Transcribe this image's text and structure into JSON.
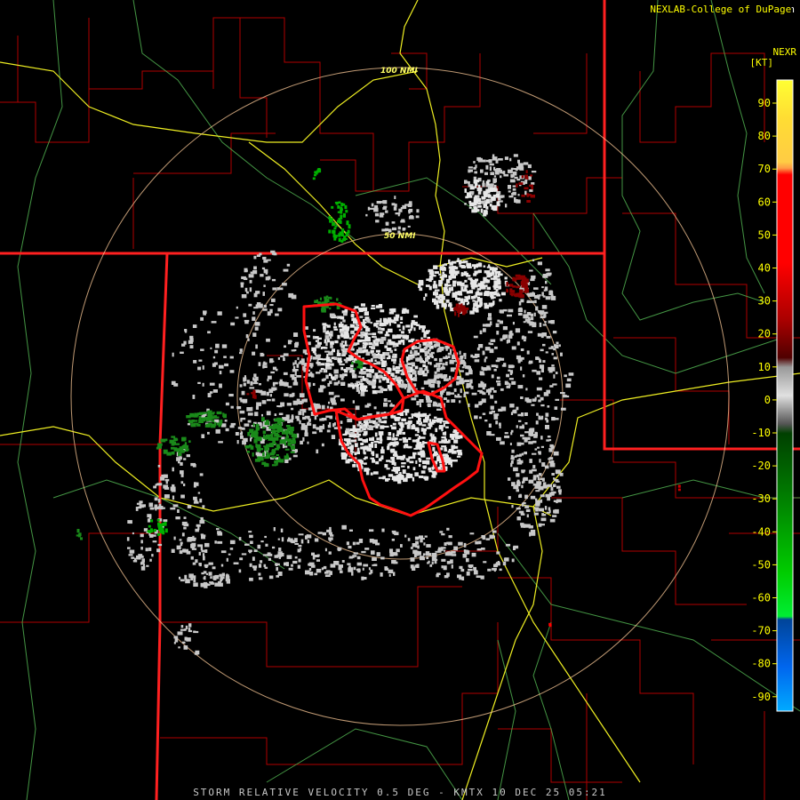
{
  "credit": {
    "text": "NEXLAB-College of DuPage",
    "icon": "k-logo-icon"
  },
  "product_code": "NEXR",
  "units": "[KT]",
  "footer": "STORM RELATIVE VELOCITY 0.5 DEG - KMTX 10 DEC 25 05:21",
  "range_rings": [
    {
      "label": "50 NMI"
    },
    {
      "label": "100 NMI"
    }
  ],
  "legend": {
    "ticks": [
      "90",
      "80",
      "70",
      "60",
      "50",
      "40",
      "30",
      "20",
      "10",
      "0",
      "-10",
      "-20",
      "-30",
      "-40",
      "-50",
      "-60",
      "-70",
      "-80",
      "-90"
    ],
    "colors": {
      "top": "#ffff00",
      "orange": "#ff9933",
      "red": "#ff0000",
      "darkred": "#7a0000",
      "gray": "#c0c0c0",
      "darkgreen": "#005a00",
      "green": "#00e000",
      "blue": "#0060ff"
    }
  },
  "map_colors": {
    "state_border": "#ff2020",
    "county_border": "#b00000",
    "highway": "#ffff33",
    "road": "#66cc66",
    "warning_polygon": "#ff0000",
    "ring": "#ffcc99"
  }
}
